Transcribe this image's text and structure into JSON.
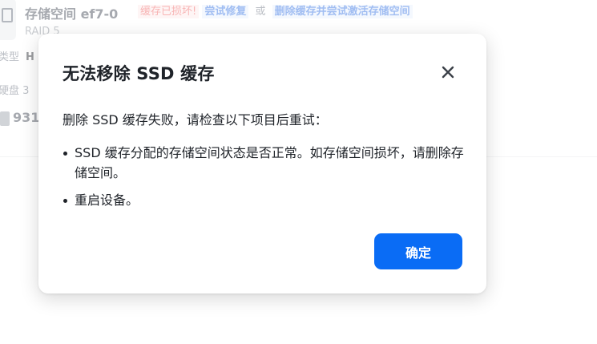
{
  "background": {
    "title": "存储空间 ef7-0",
    "alert_text": "缓存已损坏!",
    "alert_link_repair": "尝试修复",
    "alert_or": "或",
    "alert_link_delete": "删除缓存并尝试激活存储空间",
    "raid_label": "RAID 5",
    "type_label": "类型",
    "type_value": "H",
    "disk_label": "硬盘 3",
    "capacity": "931"
  },
  "dialog": {
    "title": "无法移除 SSD 缓存",
    "close_icon": "close-icon",
    "intro": "删除 SSD 缓存失败，请检查以下项目后重试：",
    "items": [
      "SSD 缓存分配的存储空间状态是否正常。如存储空间损坏，请删除存储空间。",
      "重启设备。"
    ],
    "confirm_label": "确定"
  },
  "colors": {
    "primary": "#0a6cf5",
    "error": "#f05a5a",
    "link": "#2f6fe4"
  }
}
